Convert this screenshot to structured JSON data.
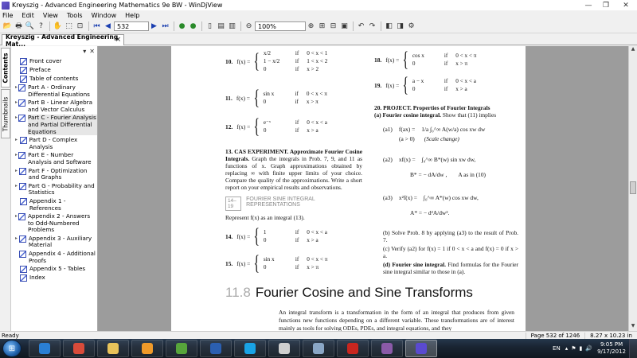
{
  "window": {
    "title": "Kreyszig - Advanced Engineering Mathematics 9e BW - WinDjView"
  },
  "menu": [
    "File",
    "Edit",
    "View",
    "Tools",
    "Window",
    "Help"
  ],
  "toolbar": {
    "page_number": "532",
    "zoom": "100%"
  },
  "doc_tab": {
    "label": "Kreyszig - Advanced Engineering Mat..."
  },
  "side_tabs": {
    "contents": "Contents",
    "thumbnails": "Thumbnails"
  },
  "toc": [
    {
      "label": "Front cover"
    },
    {
      "label": "Preface"
    },
    {
      "label": "Table of contents"
    },
    {
      "label": "Part A - Ordinary Differential Equations",
      "expandable": true
    },
    {
      "label": "Part B - Linear Algebra and Vector Calculus",
      "expandable": true
    },
    {
      "label": "Part C - Fourier Analysis and Partial Differential Equations",
      "expandable": true,
      "selected": true
    },
    {
      "label": "Part D - Complex Analysis",
      "expandable": true
    },
    {
      "label": "Part E - Number Analysis and Software",
      "expandable": true
    },
    {
      "label": "Part F - Optimization and Graphs",
      "expandable": true
    },
    {
      "label": "Part G - Probability and Statistics",
      "expandable": true
    },
    {
      "label": "Appendix 1 - References"
    },
    {
      "label": "Appendix 2 - Answers to Odd-Numbered Problems",
      "expandable": true
    },
    {
      "label": "Appendix 3 - Auxiliary Material",
      "expandable": true
    },
    {
      "label": "Appendix 4 - Additional Proofs"
    },
    {
      "label": "Appendix 5 - Tables"
    },
    {
      "label": "Index"
    }
  ],
  "doc": {
    "p10": {
      "num": "10.",
      "lhs": "f(x) =",
      "rows": [
        [
          "x/2",
          "if",
          "0 < x < 1"
        ],
        [
          "1 − x/2",
          "if",
          "1 < x < 2"
        ],
        [
          "0",
          "if",
          "x > 2"
        ]
      ]
    },
    "p11": {
      "num": "11.",
      "lhs": "f(x) =",
      "rows": [
        [
          "sin x",
          "if",
          "0 < x < π"
        ],
        [
          "0",
          "if",
          "x > π"
        ]
      ]
    },
    "p12": {
      "num": "12.",
      "lhs": "f(x) =",
      "rows": [
        [
          "e⁻ˣ",
          "if",
          "0 < x < a"
        ],
        [
          "0",
          "if",
          "x > a"
        ]
      ]
    },
    "p13": {
      "num": "13.",
      "head": "CAS EXPERIMENT. Approximate Fourier Cosine Integrals.",
      "text": "Graph the integrals in Prob. 7, 9, and 11 as functions of x. Graph approximations obtained by replacing ∞ with finite upper limits of your choice. Compare the quality of the approximations. Write a short report on your empirical results and observations."
    },
    "sect_box": {
      "range": "14–19",
      "title": "FOURIER SINE INTEGRAL REPRESENTATIONS"
    },
    "intro": "Represent f(x) as an integral (13).",
    "p14": {
      "num": "14.",
      "lhs": "f(x) =",
      "rows": [
        [
          "1",
          "if",
          "0 < x < a"
        ],
        [
          "0",
          "if",
          "x > a"
        ]
      ]
    },
    "p15": {
      "num": "15.",
      "lhs": "f(x) =",
      "rows": [
        [
          "sin x",
          "if",
          "0 < x < π"
        ],
        [
          "0",
          "if",
          "x > π"
        ]
      ]
    },
    "p18": {
      "num": "18.",
      "lhs": "f(x) =",
      "rows": [
        [
          "cos x",
          "if",
          "0 < x < π"
        ],
        [
          "0",
          "if",
          "x > π"
        ]
      ]
    },
    "p19": {
      "num": "19.",
      "lhs": "f(x) =",
      "rows": [
        [
          "a − x",
          "if",
          "0 < x < a"
        ],
        [
          "0",
          "if",
          "x > a"
        ]
      ]
    },
    "p20": {
      "num": "20.",
      "head": "PROJECT. Properties of Fourier Integrals",
      "sub_a": "(a) Fourier cosine integral.",
      "sub_a_text": "Show that (11) implies"
    },
    "eq_a1": {
      "tag": "(a1)",
      "lhs": "f(ax) =",
      "rhs": "1/a ∫₀^∞ A(w/a) cos xw dw",
      "cond": "(a > 0)",
      "note": "(Scale change)"
    },
    "eq_a2": {
      "tag": "(a2)",
      "lhs": "xf(x) =",
      "rhs": "∫₀^∞ B*(w) sin xw dw,",
      "line2": "B* = − dA/dw ,",
      "line2b": "A as in (10)"
    },
    "eq_a3": {
      "tag": "(a3)",
      "lhs": "x²f(x) =",
      "rhs": "∫₀^∞ A*(w) cos xw dw,",
      "line2": "A* = − d²A/dw²."
    },
    "p20b": "(b) Solve Prob. 8 by applying (a3) to the result of Prob. 7.",
    "p20c": "(c) Verify (a2) for f(x) = 1 if 0 < x < a and f(x) = 0 if x > a.",
    "p20d_head": "(d) Fourier sine integral.",
    "p20d_text": "Find formulas for the Fourier sine integral similar to those in (a).",
    "section_num": "11.8",
    "section_title": "Fourier Cosine and Sine Transforms",
    "para": "An integral transform is a transformation in the form of an integral that produces from given functions new functions depending on a different variable. These transformations are of interest mainly as tools for solving ODEs, PDEs, and integral equations, and they"
  },
  "status": {
    "left": "Ready",
    "page": "Page 532 of 1246",
    "size": "8.27 x 10.23 in"
  },
  "tray": {
    "lang": "EN",
    "time": "9:05 PM",
    "date": "9/17/2012"
  },
  "taskbar_apps": [
    {
      "name": "internet-explorer",
      "color": "#2a7fd4"
    },
    {
      "name": "chrome",
      "color": "#d94b3a"
    },
    {
      "name": "windows-explorer",
      "color": "#e8c35a"
    },
    {
      "name": "media-player",
      "color": "#f09a2a"
    },
    {
      "name": "utorrent",
      "color": "#57a53b"
    },
    {
      "name": "word",
      "color": "#2b5fb0"
    },
    {
      "name": "skype",
      "color": "#19a3e6"
    },
    {
      "name": "folder",
      "color": "#cfcfcf"
    },
    {
      "name": "app-window",
      "color": "#8aa6c5"
    },
    {
      "name": "acrobat",
      "color": "#c8261f"
    },
    {
      "name": "winrar",
      "color": "#8b5aa8"
    },
    {
      "name": "windjview",
      "color": "#5a4ad0",
      "active": true
    }
  ]
}
